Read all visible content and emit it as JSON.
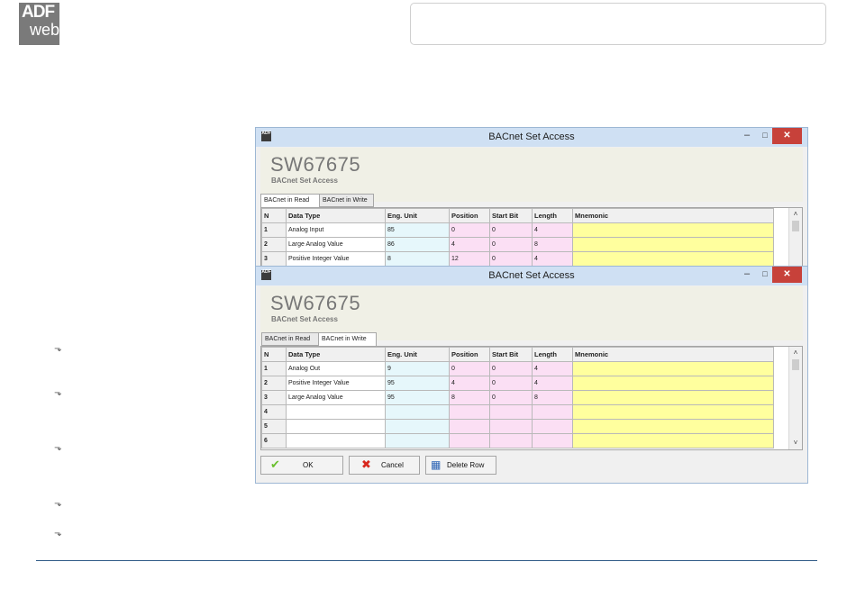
{
  "window_read": {
    "title": "BACnet Set Access",
    "app_title": "SW67675",
    "app_subtitle": "BACnet Set Access",
    "tabs": [
      "BACnet in Read",
      "BACnet in Write"
    ],
    "active_tab": "BACnet in Read",
    "columns": [
      "N",
      "Data Type",
      "Eng. Unit",
      "Position",
      "Start Bit",
      "Length",
      "Mnemonic"
    ],
    "rows": [
      [
        "1",
        "Analog Input",
        "85",
        "0",
        "0",
        "4",
        ""
      ],
      [
        "2",
        "Large Analog Value",
        "86",
        "4",
        "0",
        "8",
        ""
      ],
      [
        "3",
        "Positive Integer Value",
        "8",
        "12",
        "0",
        "4",
        ""
      ]
    ]
  },
  "window_write": {
    "title": "BACnet Set Access",
    "app_title": "SW67675",
    "app_subtitle": "BACnet Set Access",
    "tabs": [
      "BACnet in Read",
      "BACnet in Write"
    ],
    "active_tab": "BACnet in Write",
    "columns": [
      "N",
      "Data Type",
      "Eng. Unit",
      "Position",
      "Start Bit",
      "Length",
      "Mnemonic"
    ],
    "rows": [
      [
        "1",
        "Analog Out",
        "9",
        "0",
        "0",
        "4",
        ""
      ],
      [
        "2",
        "Positive Integer Value",
        "95",
        "4",
        "0",
        "4",
        ""
      ],
      [
        "3",
        "Large Analog Value",
        "95",
        "8",
        "0",
        "8",
        ""
      ],
      [
        "4",
        "",
        "",
        "",
        "",
        "",
        ""
      ],
      [
        "5",
        "",
        "",
        "",
        "",
        "",
        ""
      ],
      [
        "6",
        "",
        "",
        "",
        "",
        "",
        ""
      ]
    ],
    "buttons": {
      "ok": "OK",
      "cancel": "Cancel",
      "delete_row": "Delete Row"
    }
  },
  "icons": {
    "ok": "checkmark-icon",
    "cancel": "x-icon",
    "delete_row": "delete-table-icon",
    "bullets": "arrow-bullet-icon"
  },
  "colors": {
    "titlebar": "#cfe0f3",
    "close_button": "#c7413a",
    "cell_blue": "#e6f7fb",
    "cell_pink": "#fbdff4",
    "cell_yellow": "#ffff9e",
    "footer_line": "#2f5a86"
  },
  "logo": {
    "line1": "ADF",
    "line2": "web"
  }
}
